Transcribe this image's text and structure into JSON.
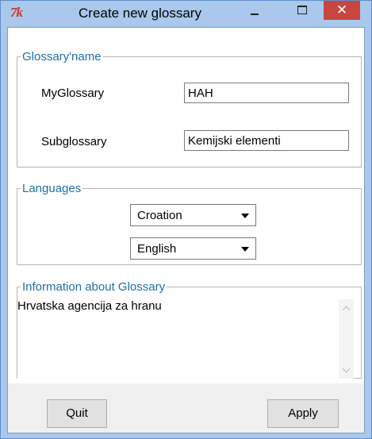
{
  "window": {
    "title": "Create new glossary",
    "icon_text": "7k",
    "close_glyph": "✕"
  },
  "glossary_name": {
    "legend": "Glossary'name",
    "myglossary_label": "MyGlossary",
    "myglossary_value": "HAH",
    "subglossary_label": "Subglossary",
    "subglossary_value": "Kemijski elementi"
  },
  "languages": {
    "legend": "Languages",
    "source_selected": "Croation",
    "target_selected": "English"
  },
  "information": {
    "legend": "Information about Glossary",
    "text": "Hrvatska agencija za hranu"
  },
  "buttons": {
    "quit_label": "Quit",
    "apply_label": "Apply"
  },
  "colors": {
    "titlebar": "#a9c8ec",
    "close_button": "#c7463d",
    "legend_text": "#1f6fa8"
  }
}
